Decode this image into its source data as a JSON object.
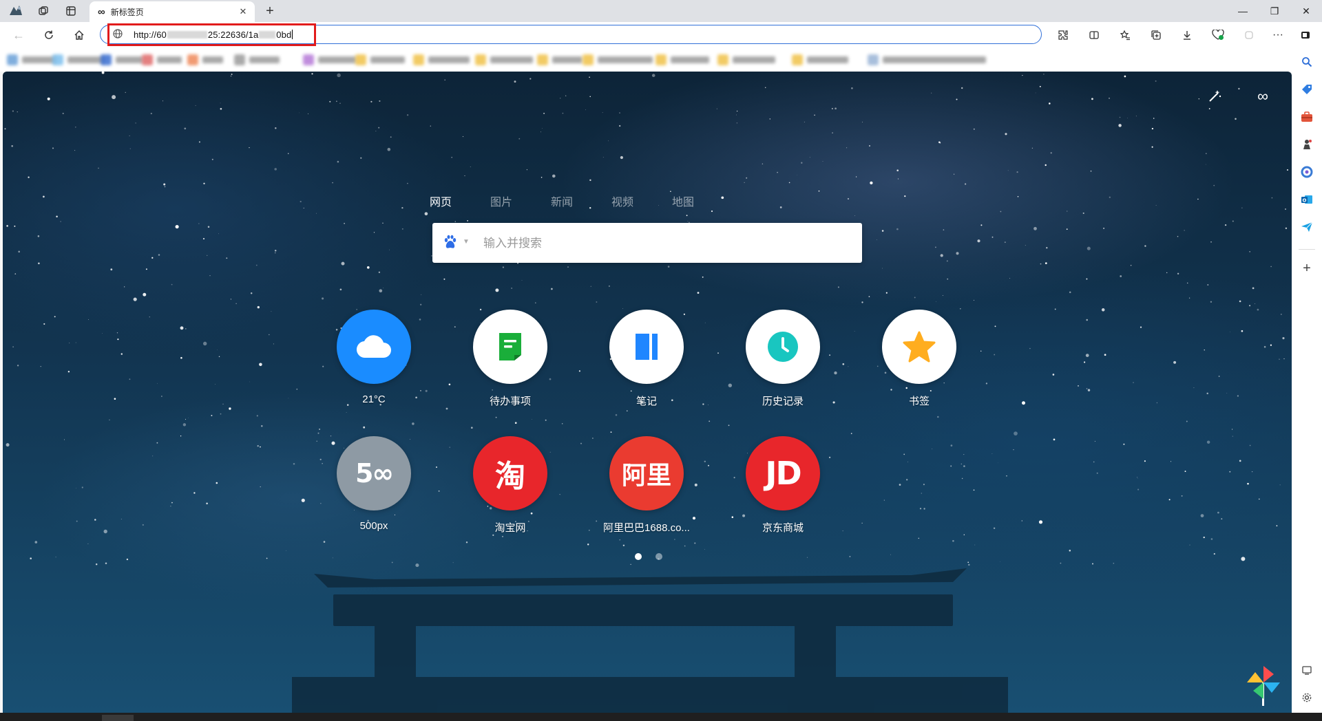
{
  "window": {
    "tab_title": "新标签页",
    "tab_favicon": "∞",
    "controls": {
      "minimize": "—",
      "restore": "❐",
      "close": "✕"
    }
  },
  "toolbar": {
    "url_prefix": "http://60",
    "url_middle": "25:22636/1a",
    "url_suffix": "0bd",
    "accent": "#2f6fd8",
    "highlight_color": "#e21b1b"
  },
  "newtab": {
    "search_tabs": [
      {
        "label": "网页",
        "active": true
      },
      {
        "label": "图片",
        "active": false
      },
      {
        "label": "新闻",
        "active": false
      },
      {
        "label": "视频",
        "active": false
      },
      {
        "label": "地图",
        "active": false
      }
    ],
    "search_placeholder": "输入并搜索",
    "search_engine_icon": "baidu-paw-icon",
    "tiles": [
      {
        "label": "21°C",
        "icon": "cloud-icon",
        "color": "#1a8cff"
      },
      {
        "label": "待办事项",
        "icon": "todo-icon",
        "color": "#ffffff"
      },
      {
        "label": "笔记",
        "icon": "note-icon",
        "color": "#ffffff"
      },
      {
        "label": "历史记录",
        "icon": "clock-icon",
        "color": "#ffffff"
      },
      {
        "label": "书签",
        "icon": "star-icon",
        "color": "#ffffff"
      },
      {
        "label": "500px",
        "icon": "500px-logo",
        "color": "#8e9aa4",
        "glyph": "5∞"
      },
      {
        "label": "淘宝网",
        "icon": "taobao-logo",
        "color": "#e8262b",
        "glyph": "淘"
      },
      {
        "label": "阿里巴巴1688.co...",
        "icon": "alibaba-logo",
        "color": "#ea3b30",
        "glyph": "阿里"
      },
      {
        "label": "京东商城",
        "icon": "jd-logo",
        "color": "#e8262b",
        "glyph": "JD"
      }
    ],
    "pages": 2,
    "current_page": 1
  }
}
